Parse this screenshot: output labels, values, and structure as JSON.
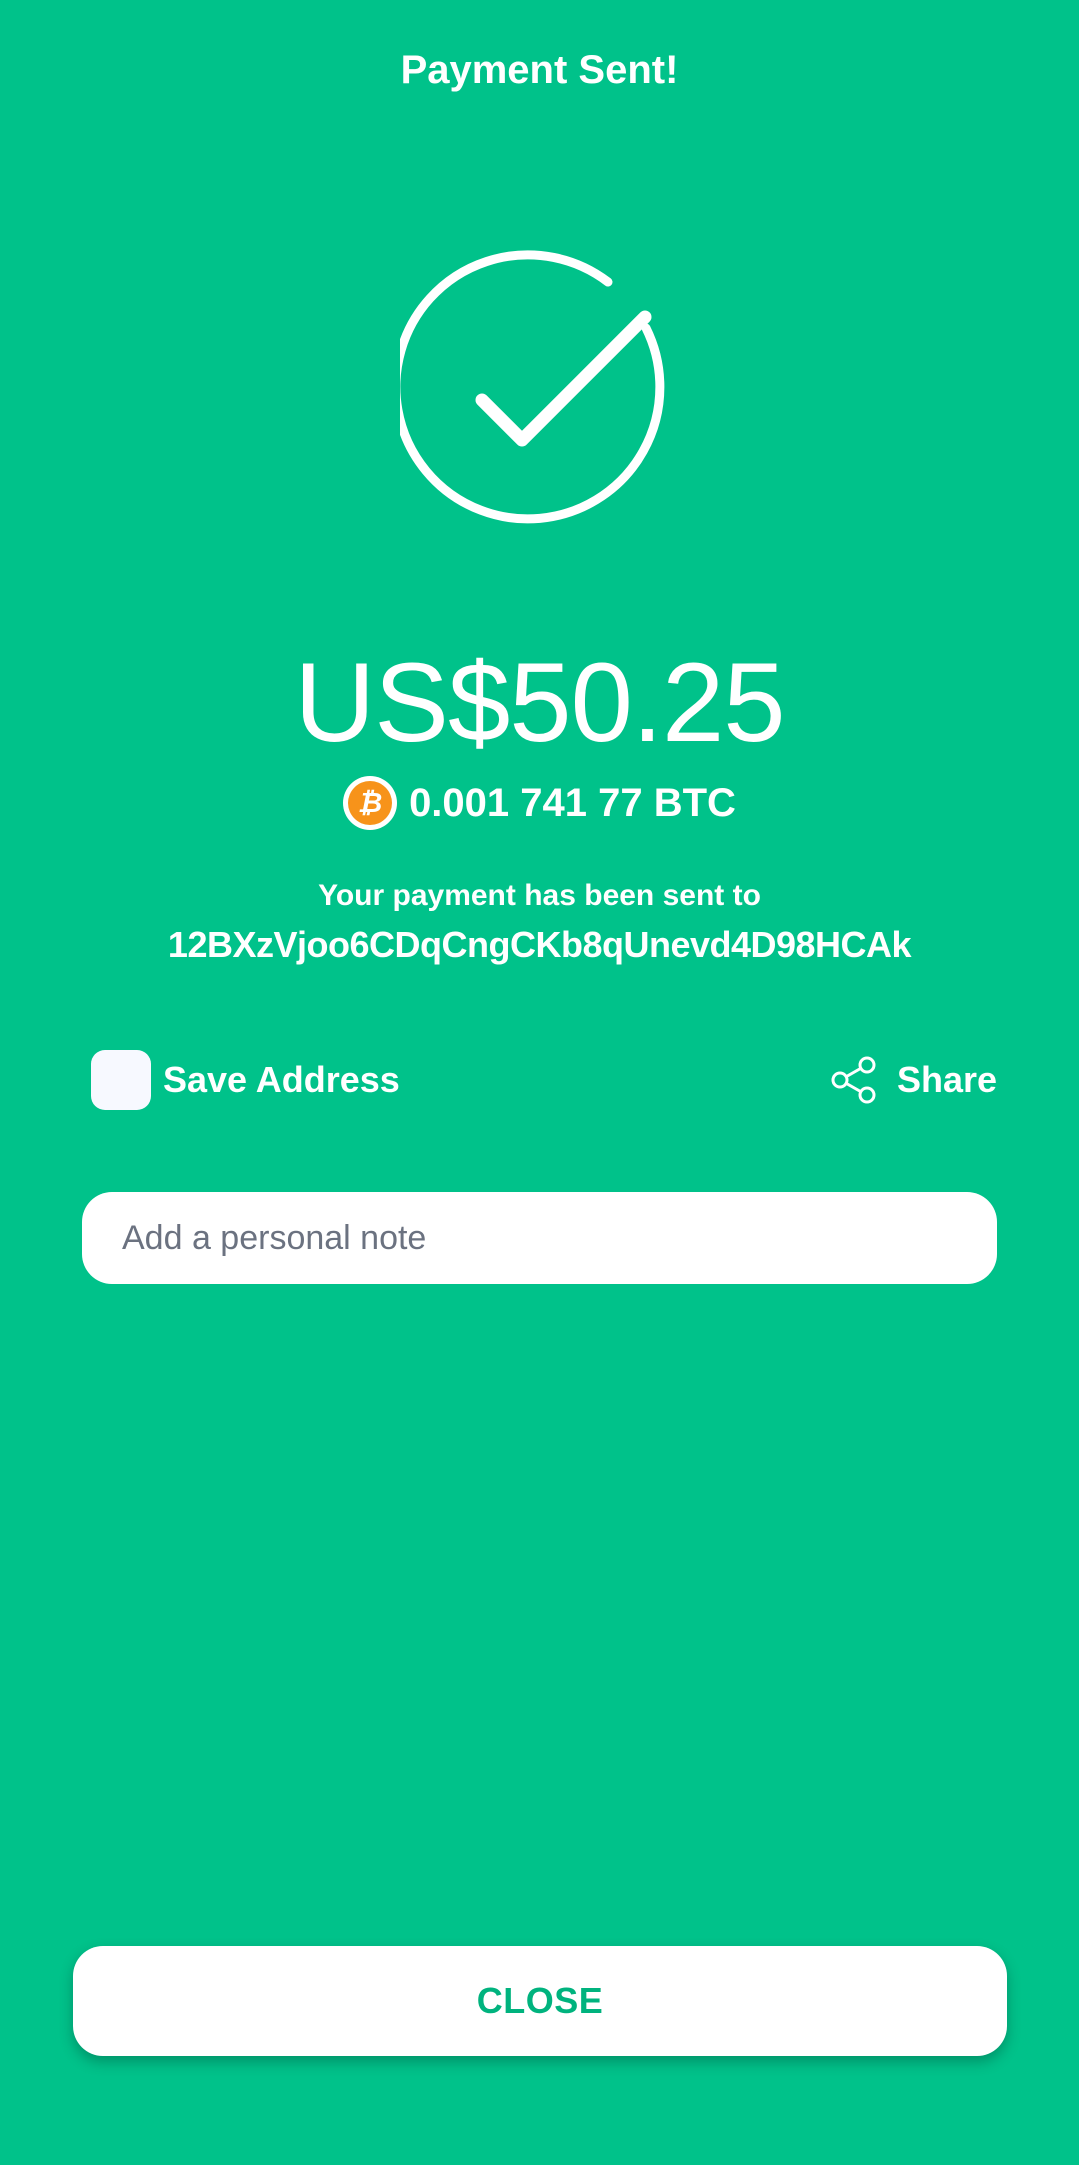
{
  "header": {
    "title": "Payment Sent!"
  },
  "status": {
    "icon": "check-circle-icon"
  },
  "amount": {
    "fiat": "US$50.25",
    "btc": "0.001 741 77 BTC",
    "coin_icon": "bitcoin-icon",
    "coin_symbol": "₿",
    "coin_color": "#f7931a"
  },
  "recipient": {
    "label": "Your payment has been sent to",
    "address": "12BXzVjoo6CDqCngCKb8qUnevd4D98HCAk"
  },
  "actions": {
    "save_address_label": "Save Address",
    "save_address_checked": false,
    "share_label": "Share",
    "share_icon": "share-icon"
  },
  "note": {
    "placeholder": "Add a personal note",
    "value": ""
  },
  "footer": {
    "close_label": "CLOSE"
  },
  "colors": {
    "background": "#00c28a",
    "accent_text": "#00b37e"
  }
}
